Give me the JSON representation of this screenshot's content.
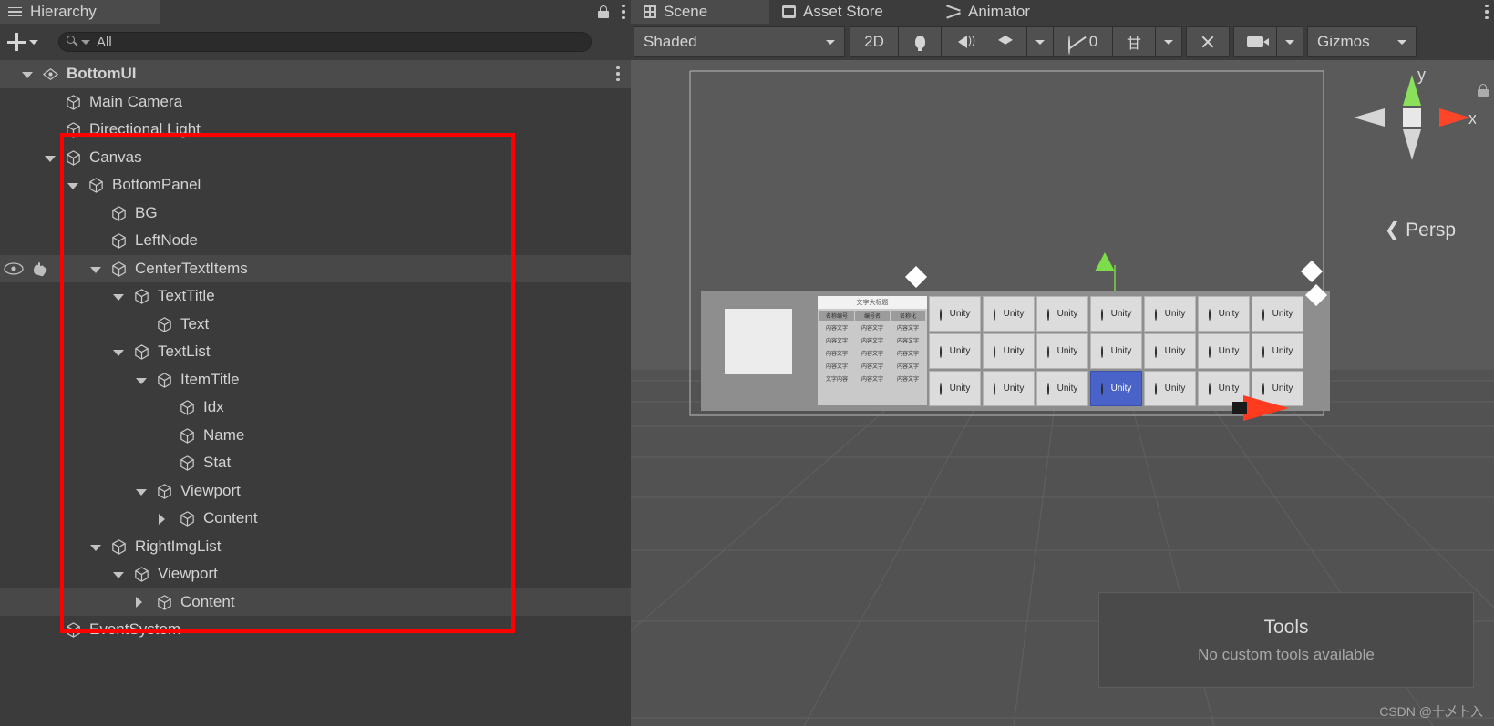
{
  "hierarchy": {
    "tab": {
      "label": "Hierarchy",
      "icon": "hamburger-icon"
    },
    "tab_icons": [
      "lock-icon",
      "kebab-menu-icon"
    ],
    "toolbar": {
      "create_label": "+",
      "create_icon": "plus-icon",
      "dropdown_icon": "chevron-down-icon",
      "search_placeholder": "All",
      "search_value": "All",
      "search_icon": "search-icon"
    },
    "rows": [
      {
        "label": "BottomUI",
        "depth": 0,
        "twisty": "open",
        "icon": "unity-scene-icon",
        "selected": true,
        "kebab": true
      },
      {
        "label": "Main Camera",
        "depth": 1,
        "twisty": "none",
        "icon": "gameobject-icon"
      },
      {
        "label": "Directional Light",
        "depth": 1,
        "twisty": "none",
        "icon": "gameobject-icon"
      },
      {
        "label": "Canvas",
        "depth": 1,
        "twisty": "open",
        "icon": "gameobject-icon"
      },
      {
        "label": "BottomPanel",
        "depth": 2,
        "twisty": "open",
        "icon": "gameobject-icon"
      },
      {
        "label": "BG",
        "depth": 3,
        "twisty": "none",
        "icon": "gameobject-icon"
      },
      {
        "label": "LeftNode",
        "depth": 3,
        "twisty": "none",
        "icon": "gameobject-icon"
      },
      {
        "label": "CenterTextItems",
        "depth": 3,
        "twisty": "open",
        "icon": "gameobject-icon",
        "hovered": true,
        "eye": true
      },
      {
        "label": "TextTitle",
        "depth": 4,
        "twisty": "open",
        "icon": "gameobject-icon"
      },
      {
        "label": "Text",
        "depth": 5,
        "twisty": "none",
        "icon": "gameobject-icon"
      },
      {
        "label": "TextList",
        "depth": 4,
        "twisty": "open",
        "icon": "gameobject-icon"
      },
      {
        "label": "ItemTitle",
        "depth": 5,
        "twisty": "open",
        "icon": "gameobject-icon"
      },
      {
        "label": "Idx",
        "depth": 6,
        "twisty": "none",
        "icon": "gameobject-icon"
      },
      {
        "label": "Name",
        "depth": 6,
        "twisty": "none",
        "icon": "gameobject-icon"
      },
      {
        "label": "Stat",
        "depth": 6,
        "twisty": "none",
        "icon": "gameobject-icon"
      },
      {
        "label": "Viewport",
        "depth": 5,
        "twisty": "open",
        "icon": "gameobject-icon"
      },
      {
        "label": "Content",
        "depth": 6,
        "twisty": "collapsed",
        "icon": "gameobject-icon"
      },
      {
        "label": "RightImgList",
        "depth": 3,
        "twisty": "open",
        "icon": "gameobject-icon"
      },
      {
        "label": "Viewport",
        "depth": 4,
        "twisty": "open",
        "icon": "gameobject-icon"
      },
      {
        "label": "Content",
        "depth": 5,
        "twisty": "collapsed",
        "icon": "gameobject-icon",
        "hovered": true
      },
      {
        "label": "EventSystem",
        "depth": 1,
        "twisty": "none",
        "icon": "gameobject-icon"
      }
    ],
    "annotation": {
      "shape": "rectangle",
      "color": "#fe0000"
    }
  },
  "scene": {
    "tabs": [
      {
        "label": "Scene",
        "icon": "grid-icon",
        "active": true
      },
      {
        "label": "Asset Store",
        "icon": "store-icon",
        "active": false
      },
      {
        "label": "Animator",
        "icon": "animator-icon",
        "active": false
      }
    ],
    "tab_kebab": "kebab-menu-icon",
    "toolbar": {
      "draw_mode": "Shaded",
      "draw_mode_caret": "chevron-down-icon",
      "mode_2d": "2D",
      "lighting_icon": "lightbulb-icon",
      "audio_icon": "speaker-icon",
      "fx_icon": "effects-icon",
      "fx_caret": "chevron-down-icon",
      "visibility_icon": "eye-off-icon",
      "visibility_count": "0",
      "audio_jp_icon": "scene-visibility-icon",
      "audio_jp_caret": "chevron-down-icon",
      "tools_icon": "tools-icon",
      "camera_icon": "camera-icon",
      "camera_caret": "chevron-down-icon",
      "gizmos_label": "Gizmos",
      "gizmos_caret": "chevron-down-icon"
    },
    "viewport": {
      "lock_icon": "lock-icon",
      "axis_gizmo": {
        "x_label": "x",
        "y_label": "y"
      },
      "projection": "Persp",
      "projection_icon": "less-than-icon",
      "tools_overlay": {
        "title": "Tools",
        "message": "No custom tools available"
      },
      "ui_preview": {
        "text_panel_title": "文字大标题",
        "text_panel_columns": [
          {
            "header": "名称编号",
            "cells": [
              "内容文字",
              "内容文字",
              "内容文字",
              "内容文字",
              "文字内容"
            ]
          },
          {
            "header": "编号名",
            "cells": [
              "内容文字",
              "内容文字",
              "内容文字",
              "内容文字",
              "内容文字"
            ]
          },
          {
            "header": "名称化",
            "cells": [
              "内容文字",
              "内容文字",
              "内容文字",
              "内容文字",
              "内容文字"
            ]
          }
        ],
        "grid_label": "Unity",
        "grid_rows": 3,
        "grid_cols": 7,
        "highlighted_cell": {
          "row": 2,
          "col": 3
        }
      }
    },
    "watermark": "CSDN @十乄卜入"
  }
}
